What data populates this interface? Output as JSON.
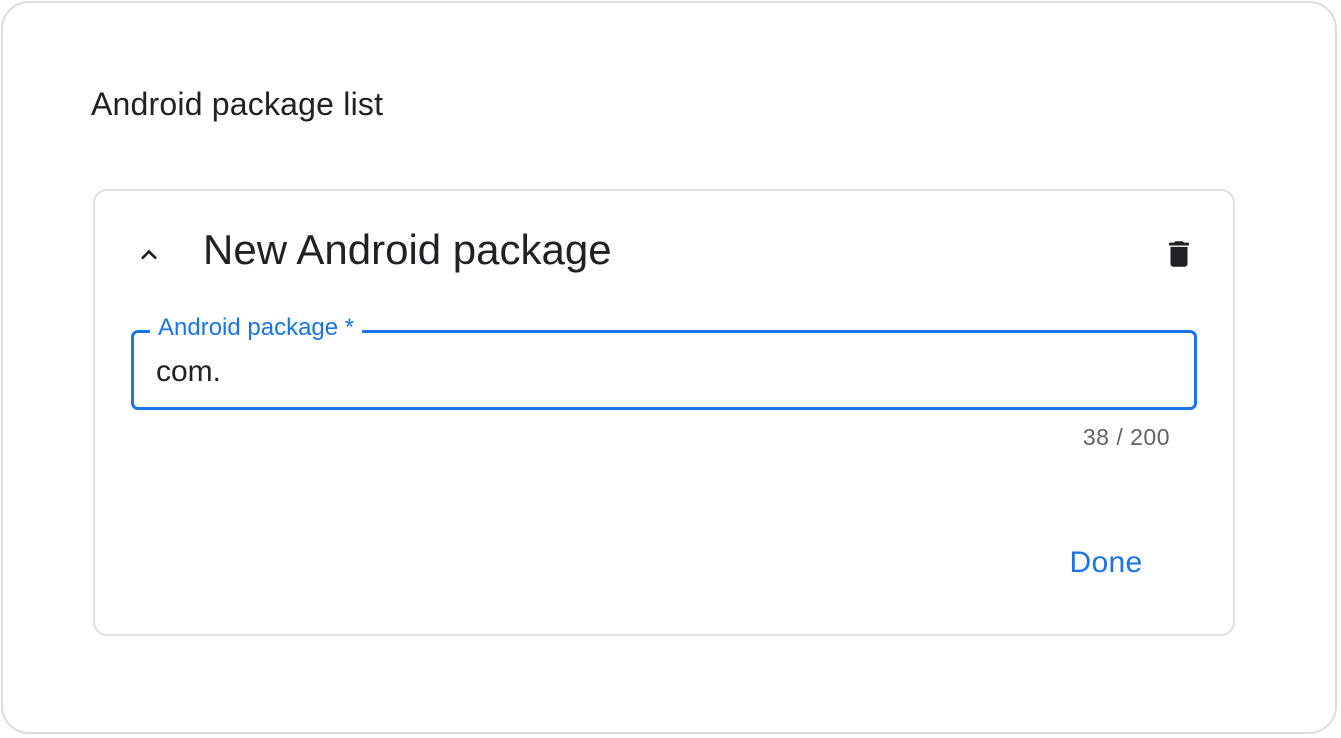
{
  "section": {
    "title": "Android package list"
  },
  "card": {
    "title": "New Android package",
    "collapse_icon": "chevron-up-icon",
    "delete_icon": "trash-icon"
  },
  "field": {
    "label": "Android package *",
    "value": "com.",
    "char_count": "38 / 200"
  },
  "actions": {
    "done_label": "Done"
  },
  "colors": {
    "accent": "#1a73e8",
    "text": "#202124",
    "muted": "#5f6368",
    "border": "#dadce0",
    "spellcheck": "#d93025"
  }
}
